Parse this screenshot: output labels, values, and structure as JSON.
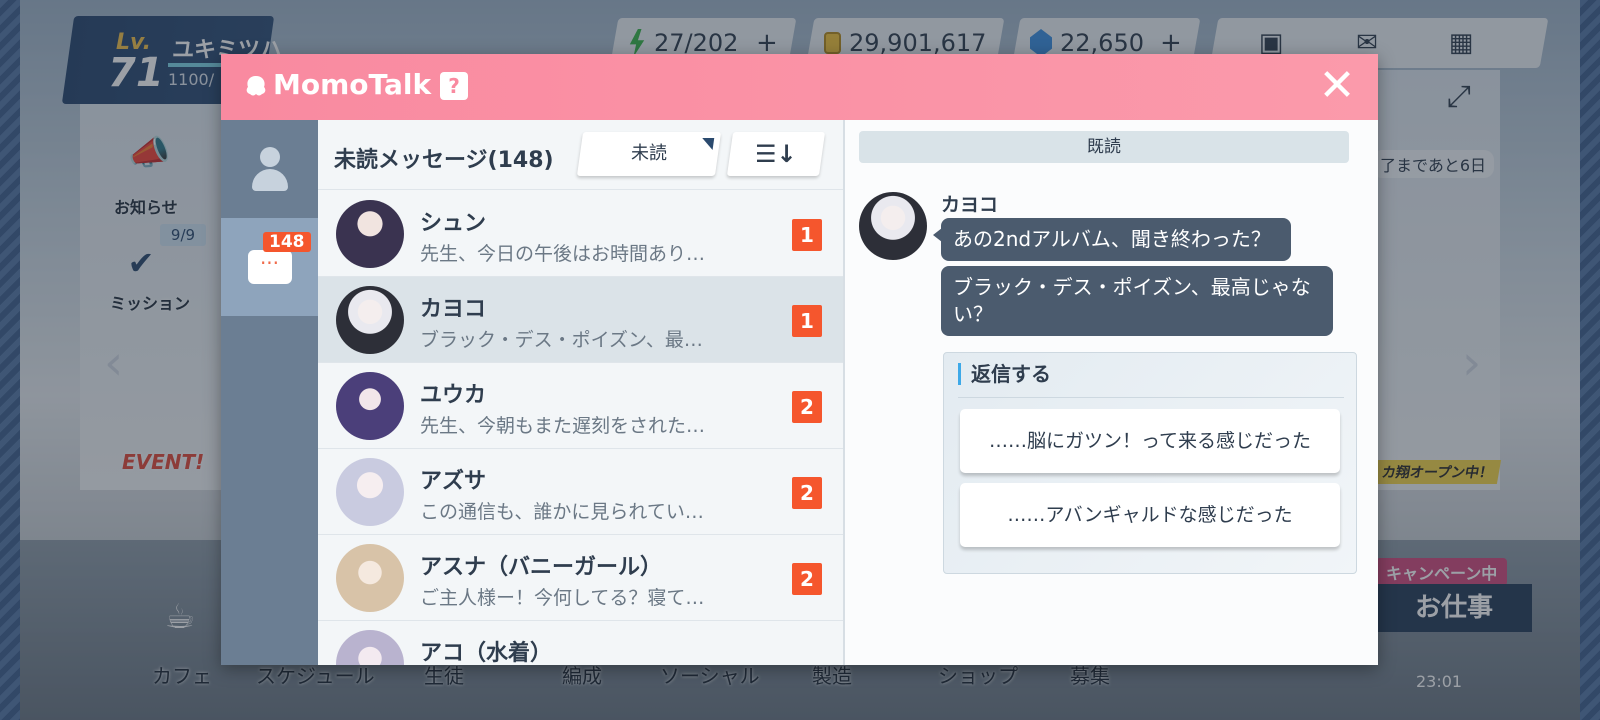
{
  "hud": {
    "level_label": "Lv.",
    "level": "71",
    "player_name": "ユキミツハ",
    "exp_text": "1100/",
    "stamina": "27/202",
    "credits": "29,901,617",
    "gems": "22,650",
    "plus": "+"
  },
  "side": {
    "notice": "お知らせ",
    "mission_progress": "9/9",
    "mission": "ミッション",
    "event": "EVENT!"
  },
  "right_panel": {
    "countdown": "了まであと6日",
    "open_banner": "カ翔オープン中！",
    "campaign": "キャンペーン中",
    "work": "お仕事"
  },
  "bottom_nav": [
    "カフェ",
    "スケジュール",
    "生徒",
    "編成",
    "ソーシャル",
    "製造",
    "ショップ",
    "募集"
  ],
  "clock": "23:01",
  "momotalk": {
    "title": "MomoTalk",
    "help": "?",
    "close": "✕",
    "unread_badge": "148",
    "list_title": "未読メッセージ(148)",
    "filter_label": "未読",
    "sort_label": "☰↓",
    "conversations": [
      {
        "name": "シュン",
        "preview": "先生、今日の午後はお時間あり…",
        "count": "1",
        "avatar_color": "#3a3350"
      },
      {
        "name": "カヨコ",
        "preview": "ブラック・デス・ポイズン、最…",
        "count": "1",
        "avatar_color": "#2d2f38"
      },
      {
        "name": "ユウカ",
        "preview": "先生、今朝もまた遅刻をされた…",
        "count": "2",
        "avatar_color": "#4b3f7a"
      },
      {
        "name": "アズサ",
        "preview": "この通信も、誰かに見られてい…",
        "count": "2",
        "avatar_color": "#c9cbe0"
      },
      {
        "name": "アスナ（バニーガール）",
        "preview": "ご主人様ー！今何してる？寝て…",
        "count": "2",
        "avatar_color": "#d8c3a8"
      },
      {
        "name": "アコ（水着）",
        "preview": "",
        "count": "",
        "avatar_color": "#b9b3cf"
      }
    ],
    "chat": {
      "read_label": "既読",
      "sender": "カヨコ",
      "messages": [
        "あの2ndアルバム、聞き終わった？",
        "ブラック・デス・ポイズン、最高じゃない？"
      ],
      "reply_title": "返信する",
      "reply_options": [
        "……脳にガツン！って来る感じだった",
        "……アバンギャルドな感じだった"
      ]
    }
  }
}
